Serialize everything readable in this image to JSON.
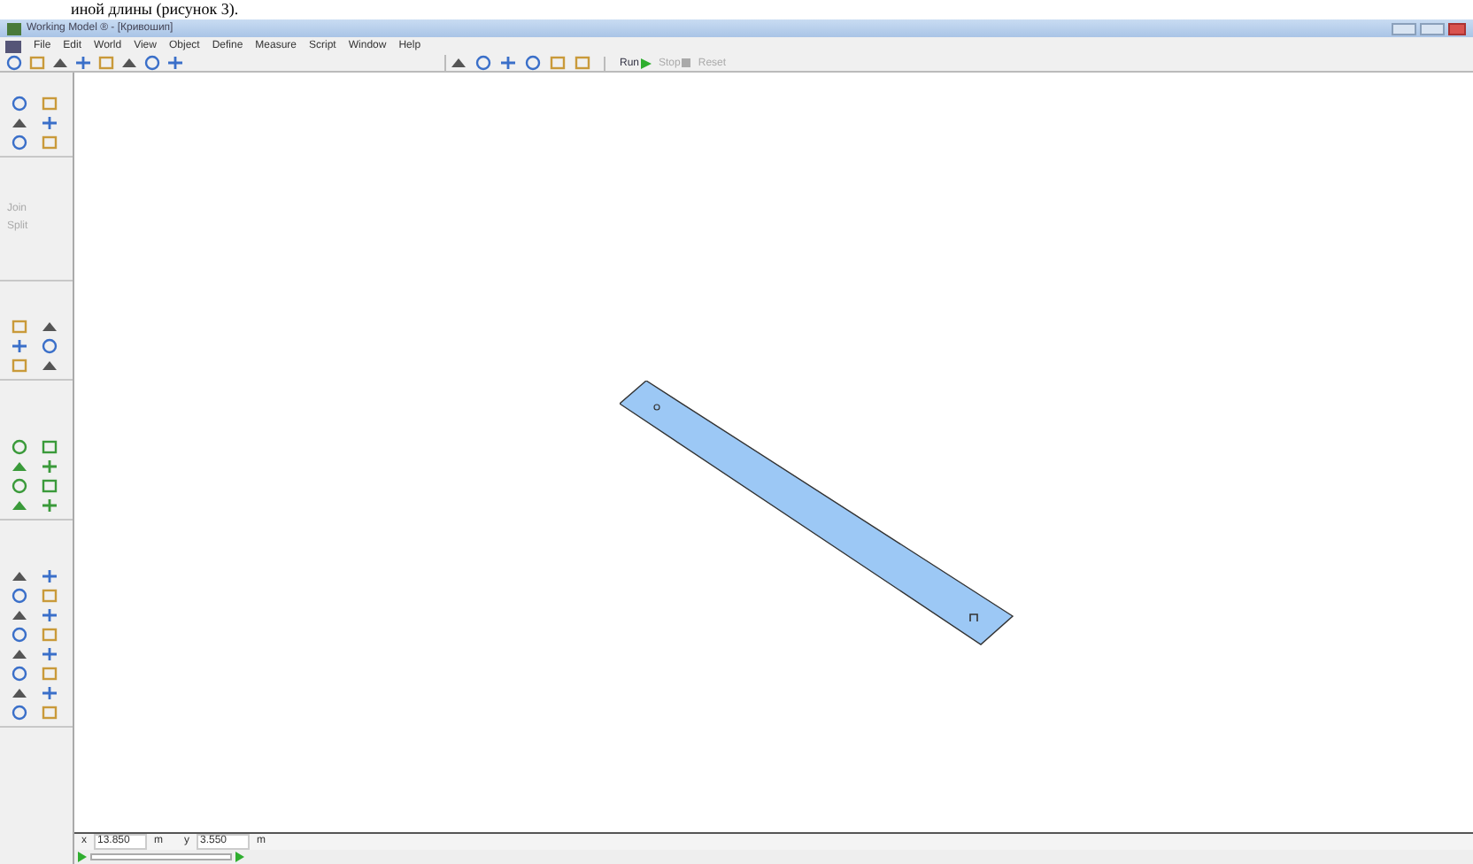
{
  "caption": "иной длины (рисунок 3).",
  "window": {
    "title": "Working Model ® - [Кривошип]"
  },
  "menu": [
    "File",
    "Edit",
    "World",
    "View",
    "Object",
    "Define",
    "Measure",
    "Script",
    "Window",
    "Help"
  ],
  "run_controls": [
    {
      "label": "Run",
      "kind": "run",
      "disabled": false
    },
    {
      "label": "Stop",
      "kind": "stop",
      "disabled": true
    },
    {
      "label": "Reset",
      "kind": "reset",
      "disabled": true
    }
  ],
  "palette": [
    {
      "label": "Join",
      "disabled": true
    },
    {
      "label": "Split",
      "disabled": true
    }
  ],
  "coords": {
    "x_label": "x",
    "x_value": "13.850",
    "x_unit": "m",
    "y_label": "y",
    "y_value": "3.550",
    "y_unit": "m"
  }
}
